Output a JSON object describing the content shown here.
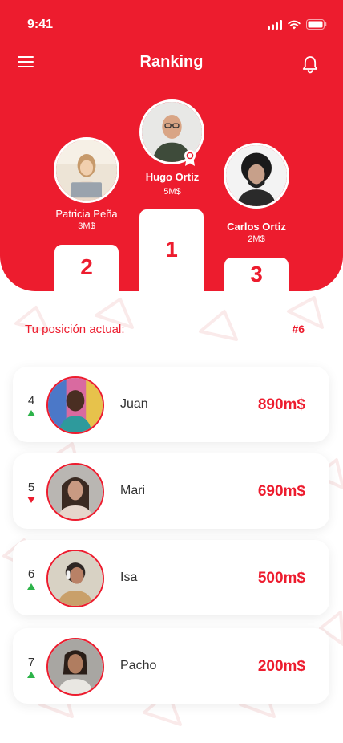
{
  "status_bar": {
    "time": "9:41"
  },
  "header": {
    "title": "Ranking"
  },
  "podium": {
    "first": {
      "name": "Hugo Ortiz",
      "amount": "5M$",
      "place": "1"
    },
    "second": {
      "name": "Patricia Peña",
      "amount": "3M$",
      "place": "2"
    },
    "third": {
      "name": "Carlos Ortiz",
      "amount": "2M$",
      "place": "3"
    }
  },
  "current_position": {
    "label": "Tu posición actual:",
    "value": "#6"
  },
  "ranking_list": [
    {
      "rank": "4",
      "trend": "up",
      "name": "Juan",
      "amount": "890m$"
    },
    {
      "rank": "5",
      "trend": "down",
      "name": "Mari",
      "amount": "690m$"
    },
    {
      "rank": "6",
      "trend": "up",
      "name": "Isa",
      "amount": "500m$"
    },
    {
      "rank": "7",
      "trend": "up",
      "name": "Pacho",
      "amount": "200m$"
    }
  ],
  "colors": {
    "brand": "#ED1C2E",
    "trend_up": "#2DB34A",
    "trend_down": "#ED1C2E"
  },
  "icons": [
    "signal-icon",
    "wifi-icon",
    "battery-icon",
    "menu-icon",
    "bell-icon",
    "badge-icon",
    "trend-up-icon",
    "trend-down-icon"
  ]
}
